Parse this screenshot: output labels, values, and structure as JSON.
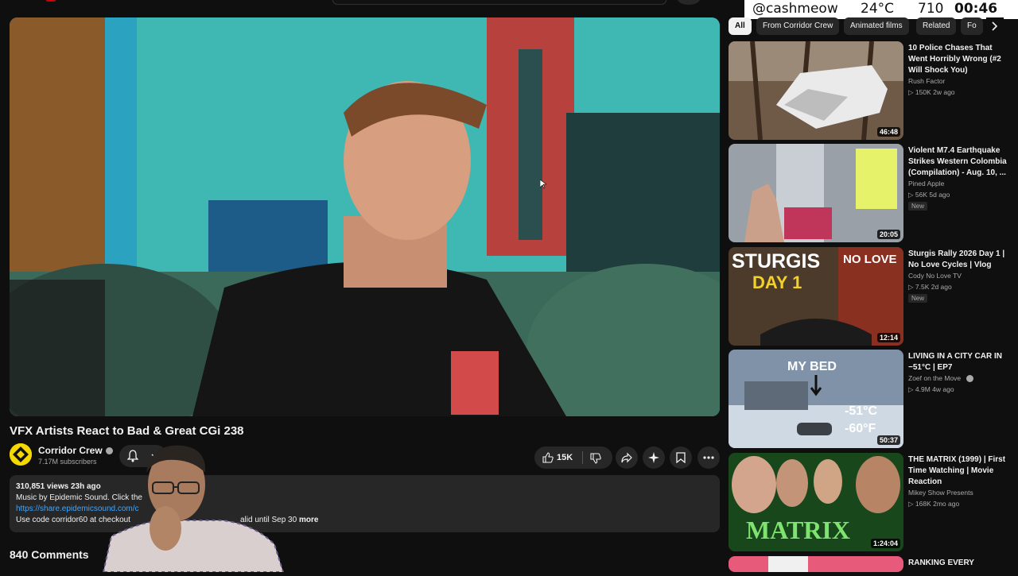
{
  "overlay": {
    "handle": "@cashmeow",
    "temp": "24°C",
    "count": "710",
    "time": "00:46"
  },
  "video": {
    "title": "VFX Artists React to Bad & Great CGi 238",
    "channel": "Corridor Crew",
    "subscribers": "7.17M subscribers",
    "likes": "15K"
  },
  "description": {
    "stats": "310,851 views  23h ago",
    "music": "Music by Epidemic Sound. Click the",
    "link": "https://share.epidemicsound.com/c",
    "code": "Use code corridor60 at checkout",
    "valid": "alid until Sep 30",
    "more": "more"
  },
  "comments": {
    "label": "840 Comments"
  },
  "chips": [
    "All",
    "From Corridor Crew",
    "Animated films",
    "Related",
    "Fo"
  ],
  "recs": [
    {
      "title": "10 Police Chases That Went Horribly Wrong (#2 Will Shock You)",
      "channel": "Rush Factor",
      "meta": "▷ 150K  2w ago",
      "duration": "46:48",
      "badge": ""
    },
    {
      "title": "Violent M7.4 Earthquake Strikes Western Colombia (Compilation) - Aug. 10, ...",
      "channel": "Pined Apple",
      "meta": "▷ 56K  5d ago",
      "duration": "20:05",
      "badge": "New"
    },
    {
      "title": "Sturgis Rally 2026 Day 1 | No Love Cycles | Vlog",
      "channel": "Cody No Love TV",
      "meta": "▷ 7.5K  2d ago",
      "duration": "12:14",
      "badge": "New"
    },
    {
      "title": "LIVING IN A CITY CAR IN −51°C | EP7",
      "channel": "Zoef on the Move",
      "meta": "▷ 4.9M  4w ago",
      "duration": "50:37",
      "badge": ""
    },
    {
      "title": "THE MATRIX (1999) | First Time Watching | Movie Reaction",
      "channel": "Mikey Show Presents",
      "meta": "▷ 168K  2mo ago",
      "duration": "1:24:04",
      "badge": ""
    },
    {
      "title": "RANKING EVERY",
      "channel": "",
      "meta": "",
      "duration": "",
      "badge": ""
    }
  ],
  "thumb_text": {
    "sturgis": "STURGIS",
    "day1": "DAY 1",
    "nolove": "NO LOVE",
    "mybed": "MY BED",
    "tempc": "-51°C",
    "tempf": "-60°F",
    "matrix": "MATRIX"
  }
}
